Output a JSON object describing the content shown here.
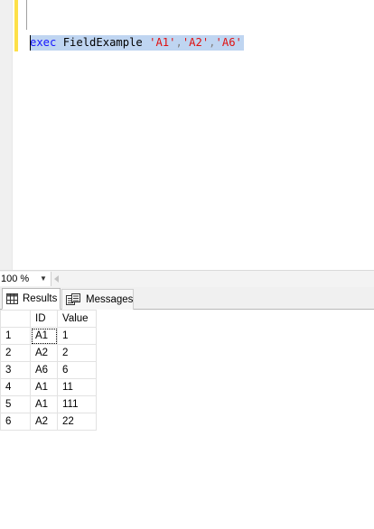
{
  "editor": {
    "keyword": "exec",
    "procedure": "FieldExample",
    "args": [
      "'A1'",
      "'A2'",
      "'A6'"
    ],
    "separator": ","
  },
  "zoom": {
    "value": "100 %"
  },
  "tabs": [
    {
      "label": "Results",
      "icon": "grid-icon"
    },
    {
      "label": "Messages",
      "icon": "messages-icon"
    }
  ],
  "grid": {
    "columns": [
      "ID",
      "Value"
    ],
    "rows": [
      {
        "num": "1",
        "id": "A1",
        "value": "1"
      },
      {
        "num": "2",
        "id": "A2",
        "value": "2"
      },
      {
        "num": "3",
        "id": "A6",
        "value": "6"
      },
      {
        "num": "4",
        "id": "A1",
        "value": "11"
      },
      {
        "num": "5",
        "id": "A1",
        "value": "111"
      },
      {
        "num": "6",
        "id": "A2",
        "value": "22"
      }
    ]
  },
  "colors": {
    "keyword": "#1616ff",
    "string": "#e01010",
    "selection": "#bfd5f1",
    "change_bar": "#fde048"
  }
}
